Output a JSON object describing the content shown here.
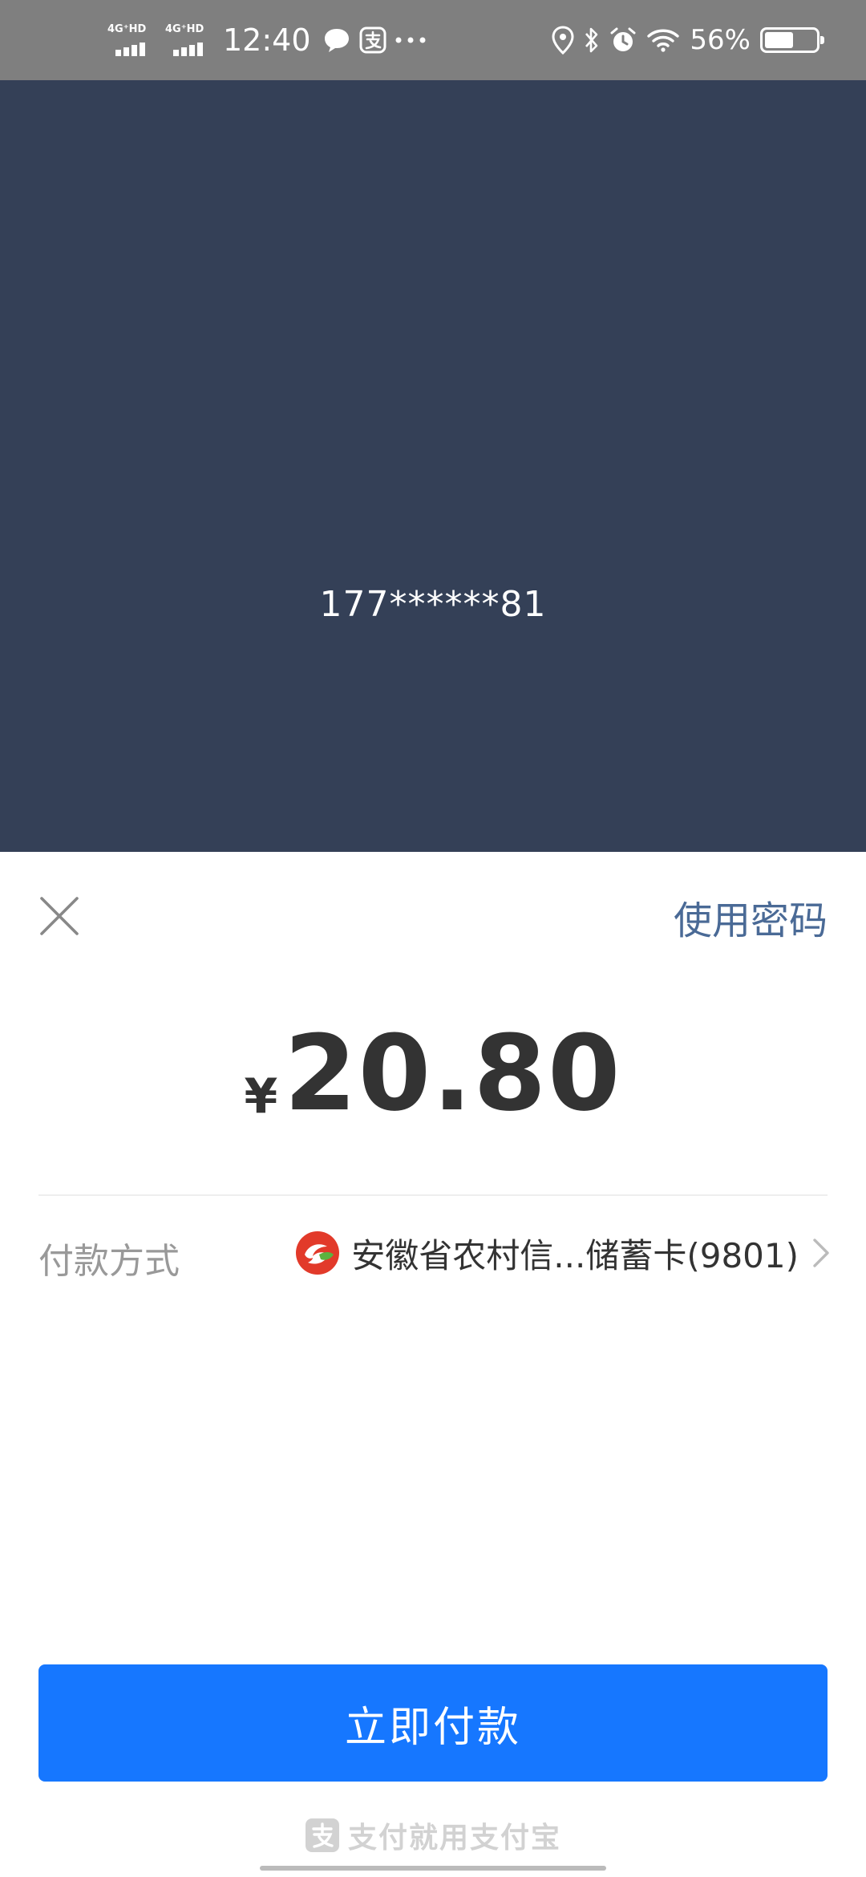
{
  "status_bar": {
    "network_1": "4G⁺HD",
    "network_2": "4G⁺HD",
    "time": "12:40",
    "battery_percent": "56%",
    "battery_level": 0.56,
    "icons": [
      "chat-bubble-icon",
      "alipay-icon",
      "more-dots-icon",
      "location-icon",
      "bluetooth-icon",
      "alarm-icon",
      "wifi-icon",
      "battery-icon"
    ]
  },
  "overlay": {
    "account": "177******81",
    "background": "#344057"
  },
  "sheet": {
    "close_icon": "close-icon",
    "use_password": "使用密码",
    "amount": {
      "currency": "¥",
      "value": "20.80"
    },
    "payment_method": {
      "label": "付款方式",
      "bank_logo": "bank-logo-icon",
      "value": "安徽省农村信...储蓄卡(9801)",
      "chevron": "chevron-right-icon"
    },
    "pay_button": {
      "label": "立即付款",
      "color": "#1677ff"
    },
    "footer": {
      "icon": "alipay-logo-icon",
      "text": "支付就用支付宝"
    }
  }
}
